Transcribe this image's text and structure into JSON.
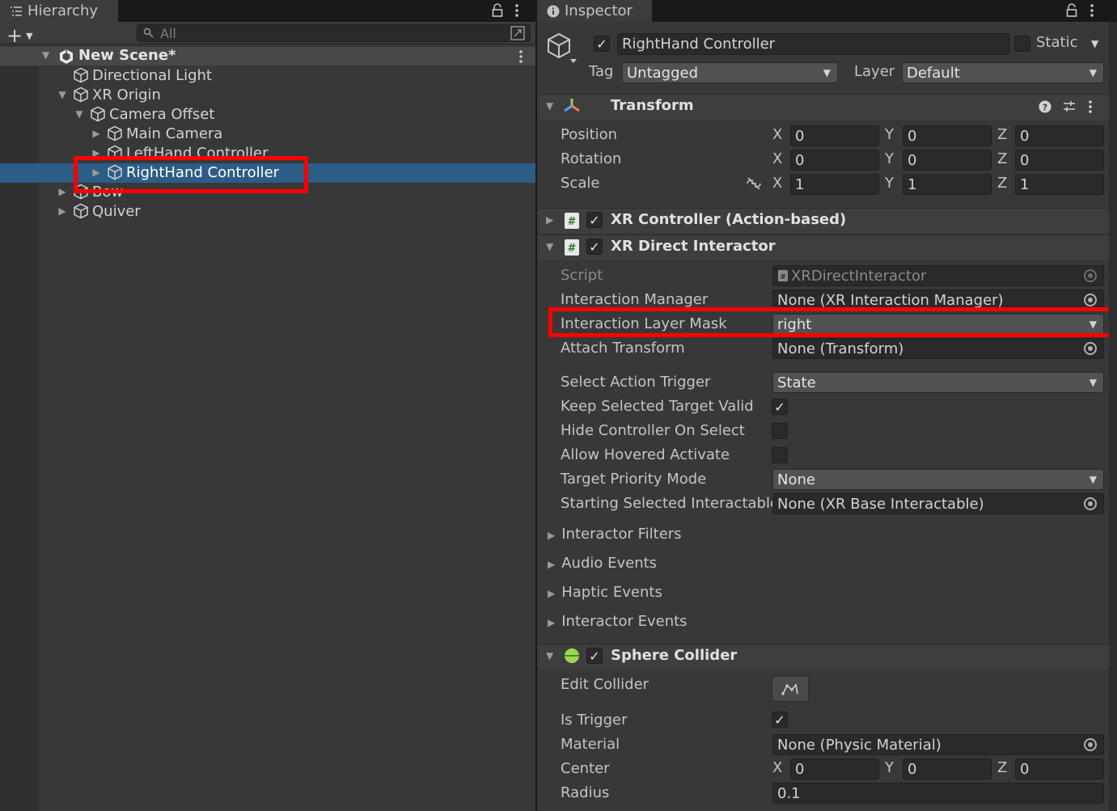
{
  "hierarchy": {
    "tab_label": "Hierarchy",
    "add_label": "+",
    "search_placeholder": "All",
    "scene_name": "New Scene*",
    "items": [
      {
        "label": "Directional Light",
        "depth": 0,
        "expand": "none"
      },
      {
        "label": "XR Origin",
        "depth": 0,
        "expand": "open"
      },
      {
        "label": "Camera Offset",
        "depth": 1,
        "expand": "open"
      },
      {
        "label": "Main Camera",
        "depth": 2,
        "expand": "closed"
      },
      {
        "label": "LeftHand Controller",
        "depth": 2,
        "expand": "closed"
      },
      {
        "label": "RightHand Controller",
        "depth": 2,
        "expand": "closed",
        "selected": true
      },
      {
        "label": "Bow",
        "depth": 0,
        "expand": "closed"
      },
      {
        "label": "Quiver",
        "depth": 0,
        "expand": "closed"
      }
    ]
  },
  "inspector": {
    "tab_label": "Inspector",
    "object_name": "RightHand Controller",
    "static_label": "Static",
    "tag_label": "Tag",
    "tag_value": "Untagged",
    "layer_label": "Layer",
    "layer_value": "Default",
    "transform": {
      "title": "Transform",
      "position_label": "Position",
      "rotation_label": "Rotation",
      "scale_label": "Scale",
      "position": {
        "x": "0",
        "y": "0",
        "z": "0"
      },
      "rotation": {
        "x": "0",
        "y": "0",
        "z": "0"
      },
      "scale": {
        "x": "1",
        "y": "1",
        "z": "1"
      }
    },
    "xr_controller_title": "XR Controller (Action-based)",
    "xr_direct": {
      "title": "XR Direct Interactor",
      "script_label": "Script",
      "script_value": "XRDirectInteractor",
      "interaction_manager_label": "Interaction Manager",
      "interaction_manager_value": "None (XR Interaction Manager)",
      "layer_mask_label": "Interaction Layer Mask",
      "layer_mask_value": "right",
      "attach_transform_label": "Attach Transform",
      "attach_transform_value": "None (Transform)",
      "select_action_trigger_label": "Select Action Trigger",
      "select_action_trigger_value": "State",
      "keep_selected_label": "Keep Selected Target Valid",
      "keep_selected_checked": true,
      "hide_controller_label": "Hide Controller On Select",
      "hide_controller_checked": false,
      "allow_hovered_label": "Allow Hovered Activate",
      "allow_hovered_checked": false,
      "target_priority_label": "Target Priority Mode",
      "target_priority_value": "None",
      "starting_selected_label": "Starting Selected Interactable",
      "starting_selected_value": "None (XR Base Interactable)",
      "foldouts": [
        "Interactor Filters",
        "Audio Events",
        "Haptic Events",
        "Interactor Events"
      ]
    },
    "sphere_collider": {
      "title": "Sphere Collider",
      "edit_collider_label": "Edit Collider",
      "is_trigger_label": "Is Trigger",
      "is_trigger_checked": true,
      "material_label": "Material",
      "material_value": "None (Physic Material)",
      "center_label": "Center",
      "center": {
        "x": "0",
        "y": "0",
        "z": "0"
      },
      "radius_label": "Radius",
      "radius_value": "0.1"
    },
    "axis_labels": {
      "x": "X",
      "y": "Y",
      "z": "Z"
    }
  },
  "colors": {
    "selection": "#2c5d87",
    "highlight_box": "#ff0000",
    "panel_bg": "#383838"
  }
}
